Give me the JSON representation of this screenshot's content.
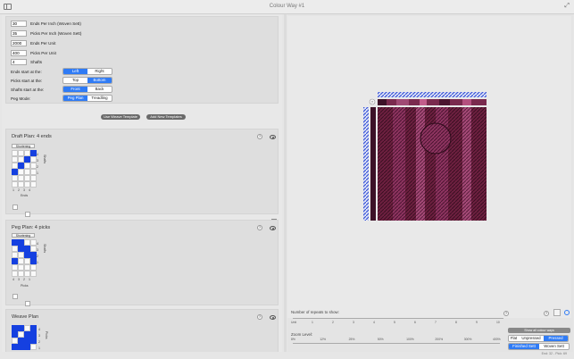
{
  "window": {
    "title": "Colour Way #1"
  },
  "settings": {
    "fields": [
      {
        "value": "30",
        "label": "Ends Per Inch (Woven Sett)"
      },
      {
        "value": "35",
        "label": "Picks Per Inch (Woven Sett)"
      },
      {
        "value": "2000",
        "label": "Ends Per Unit"
      },
      {
        "value": "400",
        "label": "Picks Per Unit"
      },
      {
        "value": "4",
        "label": "Shafts"
      }
    ],
    "segments": [
      {
        "label": "Ends start at the:",
        "options": [
          "Left",
          "Right"
        ],
        "selected": 0
      },
      {
        "label": "Picks start at the:",
        "options": [
          "Top",
          "Bottom"
        ],
        "selected": 1
      },
      {
        "label": "Shafts start at the:",
        "options": [
          "Front",
          "Back"
        ],
        "selected": 0
      },
      {
        "label": "Peg Mode:",
        "options": [
          "Peg Plan",
          "Treadling"
        ],
        "selected": 0
      }
    ],
    "use_weave_template": "Use Weave Template",
    "add_new_templates": "Add New Templates"
  },
  "draft_plan": {
    "title": "Draft Plan:  4 ends",
    "tag": "Shortening",
    "help": "?",
    "grid": [
      [
        0,
        0,
        0,
        1
      ],
      [
        0,
        0,
        1,
        0
      ],
      [
        0,
        1,
        0,
        0
      ],
      [
        1,
        0,
        0,
        0
      ],
      [
        0,
        0,
        0,
        0
      ],
      [
        0,
        0,
        0,
        0
      ]
    ],
    "col_labels": [
      "1",
      "2",
      "3",
      "4"
    ],
    "row_labels": [
      "4",
      "3",
      "2",
      "1"
    ],
    "axis_bottom": "Ends",
    "axis_side": "Shafts"
  },
  "peg_plan": {
    "title": "Peg Plan:  4 picks",
    "tag": "Shortening",
    "help": "?",
    "grid": [
      [
        1,
        1,
        0,
        0
      ],
      [
        0,
        1,
        1,
        0
      ],
      [
        0,
        0,
        1,
        1
      ],
      [
        1,
        0,
        0,
        1
      ],
      [
        0,
        0,
        0,
        0
      ],
      [
        0,
        0,
        0,
        0
      ]
    ],
    "col_labels": [
      "4",
      "3",
      "2",
      "1"
    ],
    "row_labels": [
      "4",
      "3",
      "2",
      "1"
    ],
    "axis_bottom": "Picks",
    "axis_side": "Shafts"
  },
  "weave_plan": {
    "title": "Weave Plan",
    "help": "?",
    "grid": [
      [
        1,
        1,
        0,
        1
      ],
      [
        1,
        0,
        1,
        1
      ],
      [
        0,
        1,
        1,
        1
      ],
      [
        1,
        1,
        1,
        0
      ]
    ],
    "row_labels": [
      "4",
      "3",
      "2",
      "1"
    ],
    "axis_side": "Picks"
  },
  "repeats": {
    "label": "Number of repeats to show:",
    "ticks": [
      "Unit",
      "1",
      "2",
      "3",
      "4",
      "5",
      "6",
      "7",
      "8",
      "9",
      "10"
    ],
    "help": "?"
  },
  "zoom": {
    "label": "Zoom Level:",
    "ticks": [
      "8%",
      "12%",
      "25%",
      "50%",
      "100%",
      "200%",
      "300%",
      "400%"
    ]
  },
  "view": {
    "show_all": "Show all colour ways",
    "finish_options": [
      "Flat",
      "Unpressed",
      "Pressed"
    ],
    "finish_selected": 2,
    "sett_options": [
      "Finished Sett",
      "Woven Sett"
    ],
    "sett_selected": 0
  },
  "status": "End: 32 - Pick: 69",
  "colors": {
    "accent": "#2f7bf5",
    "fill": "#1540e0",
    "fabric": "#6e2040"
  }
}
